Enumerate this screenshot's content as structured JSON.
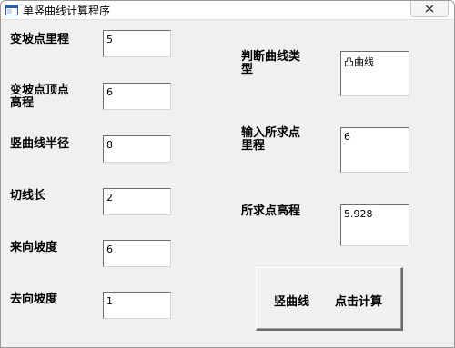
{
  "window": {
    "title": "单竖曲线计算程序"
  },
  "fields": {
    "bpd_lc": {
      "label": "变坡点里程",
      "value": "5"
    },
    "bpd_gc": {
      "label_line1": "变坡点顶点",
      "label_line2": "高程",
      "value": "6"
    },
    "radius": {
      "label": "竖曲线半径",
      "value": "8"
    },
    "tangent": {
      "label": "切线长",
      "value": "2"
    },
    "in_grade": {
      "label": "来向坡度",
      "value": "6"
    },
    "out_grade": {
      "label": "去向坡度",
      "value": "1"
    },
    "type": {
      "label_line1": "判断曲线类",
      "label_line2": "型",
      "value": "凸曲线"
    },
    "point_lc": {
      "label_line1": "输入所求点",
      "label_line2": "里程",
      "value": "6"
    },
    "point_gc": {
      "label": "所求点高程",
      "value": "5.928"
    }
  },
  "button": {
    "part1": "竖曲线",
    "part2": "点击计算"
  }
}
